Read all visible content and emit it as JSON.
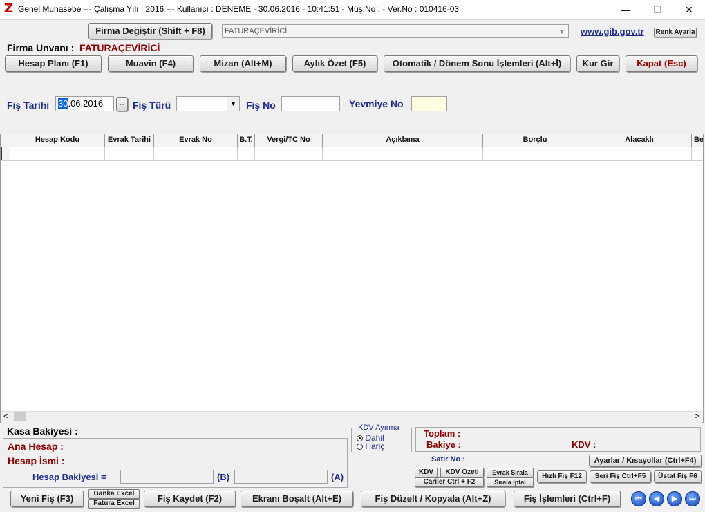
{
  "window": {
    "title": "Genel Muhasebe  ---  Çalışma Yılı : 2016  ---  Kullanıcı : DENEME - 30.06.2016 - 10:41:51 - Müş.No :  - Ver.No : 010416-03",
    "logo": "Z",
    "minimize": "—",
    "maximize": "☐",
    "close": "✕"
  },
  "top": {
    "firma_degistir": "Firma Değiştir (Shift + F8)",
    "firma_select_value": "FATURAÇEVİRİCİ",
    "gib_link": "www.gib.gov.tr",
    "renk_ayarla": "Renk Ayarla",
    "firma_unvani_label": "Firma Unvanı :",
    "firma_unvani_value": "FATURAÇEVİRİCİ"
  },
  "toolbar": {
    "hesap_plani": "Hesap Planı (F1)",
    "muavin": "Muavin (F4)",
    "mizan": "Mizan (Alt+M)",
    "aylik_ozet": "Aylık Özet (F5)",
    "otomatik": "Otomatik / Dönem Sonu İşlemleri (Alt+İ)",
    "kur_gir": "Kur Gir",
    "kapat": "Kapat (Esc)"
  },
  "form": {
    "fis_tarihi_label": "Fiş Tarihi",
    "fis_tarihi_sel": "30",
    "fis_tarihi_rest": ".06.2016",
    "dots": "...",
    "fis_turu_label": "Fiş Türü",
    "fis_no_label": "Fiş No",
    "yevmiye_label": "Yevmiye No"
  },
  "grid": {
    "columns": [
      "Hesap Kodu",
      "Evrak Tarihi",
      "Evrak No",
      "B.T.",
      "Vergi/TC No",
      "Açıklama",
      "Borçlu",
      "Alacaklı",
      "Be"
    ]
  },
  "bottom": {
    "kasa_bakiyesi": "Kasa Bakiyesi :",
    "ana_hesap": "Ana Hesap :",
    "hesap_ismi": "Hesap İsmi :",
    "hesap_bakiyesi": "Hesap Bakiyesi =",
    "b_label": "(B)",
    "a_label": "(A)",
    "kdv_ayirma": "KDV Ayırma",
    "dahil": "Dahil",
    "haric": "Hariç",
    "toplam": "Toplam :",
    "bakiye": "Bakiye :",
    "kdv": "KDV :",
    "satir_no": "Satır No :",
    "ayarlar": "Ayarlar / Kısayollar (Ctrl+F4)",
    "btn_kdv": "KDV",
    "btn_kdv_ozeti": "KDV Özeti",
    "btn_evrak_sirala": "Evrak Sırala",
    "btn_cariler": "Cariler Ctrl + F2",
    "btn_sirala_iptal": "Sırala İptal",
    "btn_hizli_fis": "Hızlı Fiş F12",
    "btn_seri_fis": "Seri Fiş Ctrl+F5",
    "btn_ustat_fis": "Üstat Fiş F6"
  },
  "actions": {
    "yeni_fis": "Yeni Fiş (F3)",
    "banka_excel": "Banka Excel",
    "fatura_excel": "Fatura Excel",
    "fis_kaydet": "Fiş Kaydet (F2)",
    "ekrani_bosalt": "Ekranı Boşalt (Alt+E)",
    "fis_duzelt": "Fiş Düzelt / Kopyala (Alt+Z)",
    "fis_islemleri": "Fiş İşlemleri (Ctrl+F)",
    "nav_first": "⏮",
    "nav_prev": "◀",
    "nav_next": "▶",
    "nav_last": "⏭"
  },
  "scroll": {
    "left": "<",
    "right": ">"
  },
  "colors": {
    "accent_red": "#8b0000",
    "label_blue": "#1c2c8c",
    "link_blue": "#1c2c8c"
  }
}
